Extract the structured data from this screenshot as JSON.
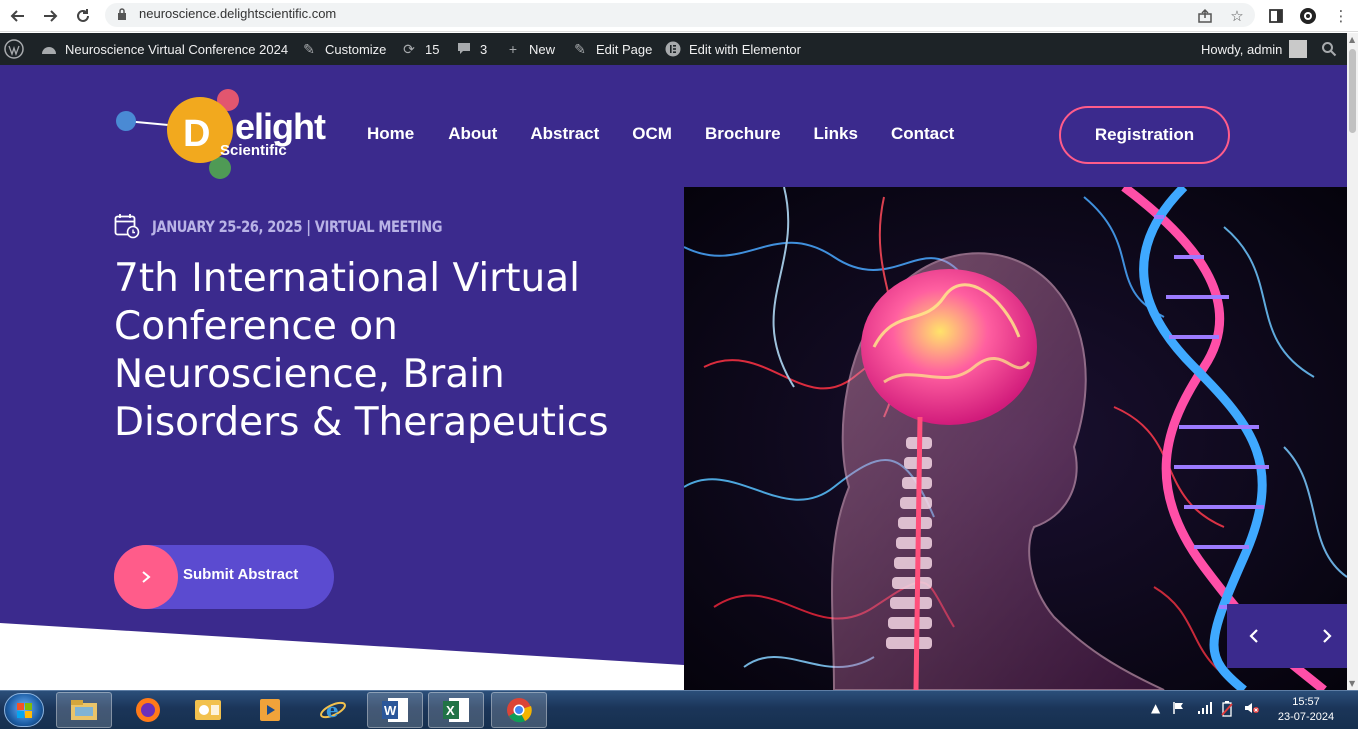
{
  "browser": {
    "url": "neuroscience.delightscientific.com",
    "nav_icons": [
      "back-arrow-icon",
      "forward-arrow-icon",
      "reload-icon"
    ],
    "right_icons": [
      "share-icon",
      "star-icon",
      "sidepanel-icon",
      "profile-icon",
      "menu-dots-icon"
    ]
  },
  "adminbar": {
    "site_name": "Neuroscience Virtual Conference 2024",
    "customize": "Customize",
    "updates_count": "15",
    "comments_count": "3",
    "new_label": "New",
    "edit_page": "Edit Page",
    "edit_elementor": "Edit with Elementor",
    "howdy": "Howdy, admin"
  },
  "header": {
    "logo_word": "Delight",
    "logo_sub": "Scientific",
    "menu": [
      "Home",
      "About",
      "Abstract",
      "OCM",
      "Brochure",
      "Links",
      "Contact"
    ],
    "registration": "Registration"
  },
  "hero": {
    "date": "JANUARY 25-26, 2025 | VIRTUAL MEETING",
    "title": "7th International Virtual Conference on Neuroscience, Brain Disorders & Therapeutics",
    "submit_label": "Submit Abstract"
  },
  "taskbar": {
    "apps": [
      "explorer",
      "firefox",
      "outlook",
      "media",
      "internet-explorer",
      "word",
      "excel",
      "chrome"
    ],
    "time": "15:57",
    "date": "23-07-2024"
  },
  "colors": {
    "hero_bg": "#3b2a8d",
    "accent_pink": "#ff5c8a",
    "button_purple": "#5b4bd0",
    "adminbar_bg": "#1d2327"
  }
}
